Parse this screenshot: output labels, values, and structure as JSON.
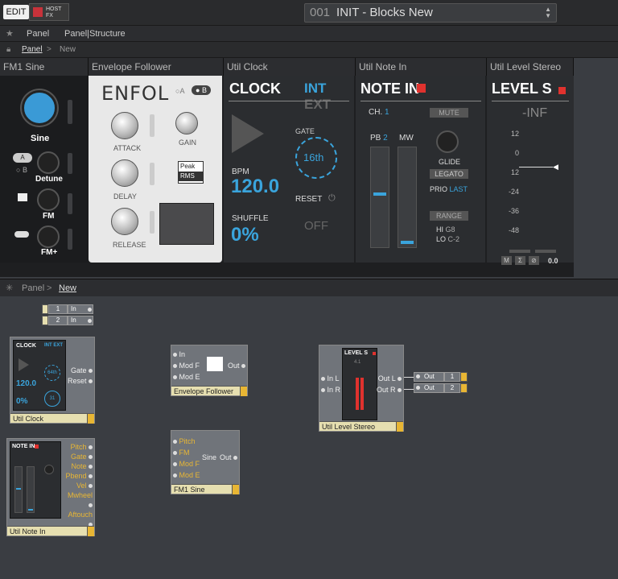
{
  "topbar": {
    "edit": "EDIT",
    "host_line1": "HOST",
    "host_line2": "FX",
    "preset_num": "001",
    "preset_name": "INIT - Blocks New"
  },
  "nav": {
    "panel": "Panel",
    "panel_structure": "Panel|Structure"
  },
  "breadcrumb1": {
    "panel": "Panel",
    "sep": ">",
    "new": "New"
  },
  "fm1": {
    "title": "FM1 Sine",
    "sine": "Sine",
    "a": "A",
    "b": "B",
    "detune": "Detune",
    "fm": "FM",
    "fmplus": "FM+"
  },
  "env": {
    "title": "Envelope Follower",
    "name": "ENFOL",
    "opt_a": "A",
    "opt_b": "B",
    "attack": "ATTACK",
    "gain": "GAIN",
    "delay": "DELAY",
    "release": "RELEASE",
    "peak": "Peak",
    "rms": "RMS"
  },
  "clock": {
    "title": "Util Clock",
    "name": "CLOCK",
    "int": "INT",
    "ext": "EXT",
    "gate_label": "GATE",
    "gate_val": "16th",
    "bpm_label": "BPM",
    "bpm_val": "120.0",
    "reset": "RESET",
    "shuffle_label": "SHUFFLE",
    "shuffle_val": "0%",
    "off": "OFF"
  },
  "note": {
    "title": "Util Note In",
    "name": "NOTE IN",
    "ch_label": "CH.",
    "ch_val": "1",
    "mute": "MUTE",
    "pb_label": "PB",
    "pb_val": "2",
    "mw": "MW",
    "glide": "GLIDE",
    "legato": "LEGATO",
    "prio_label": "PRIO",
    "prio_val": "LAST",
    "range": "RANGE",
    "hi_label": "HI",
    "hi_val": "G8",
    "lo_label": "LO",
    "lo_val": "C-2"
  },
  "level": {
    "title": "Util Level Stereo",
    "name": "LEVEL S",
    "inf": "-INF",
    "ticks": [
      "12",
      "0",
      "12",
      "-24",
      "-36",
      "-48"
    ],
    "m": "M",
    "s": "Σ",
    "p": "⊘",
    "val": "0.0"
  },
  "breadcrumb2": {
    "panel": "Panel",
    "sep": ">",
    "new": "New"
  },
  "canvas": {
    "inputs": {
      "r1n": "1",
      "r1t": "In",
      "r2n": "2",
      "r2t": "In"
    },
    "clock": {
      "footer": "Util Clock",
      "gate": "Gate",
      "reset": "Reset",
      "mini_name": "CLOCK",
      "mini_int": "INT EXT",
      "mini_bpm": "120.0",
      "mini_shuffle": "0%",
      "mini_gate": "64th",
      "mini_reset": "31"
    },
    "env": {
      "footer": "Envelope Follower",
      "in": "In",
      "modf": "Mod F",
      "mode": "Mod E",
      "out": "Out"
    },
    "level": {
      "footer": "Util Level Stereo",
      "inl": "In L",
      "inr": "In R",
      "outl": "Out L",
      "outr": "Out R",
      "mini_name": "LEVEL S",
      "mini_val": "4.1"
    },
    "outputs": {
      "o1": "Out",
      "n1": "1",
      "o2": "Out",
      "n2": "2"
    },
    "note": {
      "footer": "Util Note In",
      "ports": [
        "Pitch",
        "Gate",
        "Note",
        "Pbend",
        "Vel",
        "Mwheel",
        "Aftouch"
      ],
      "mini_name": "NOTE IN"
    },
    "fm": {
      "footer": "FM1 Sine",
      "ports": [
        "Pitch",
        "FM",
        "Mod F",
        "Mod E"
      ],
      "sine": "Sine",
      "out": "Out"
    }
  },
  "colors": {
    "accent": "#3aa4dc",
    "red": "#e0322e",
    "footer": "#e6dfb0",
    "footer_btn": "#e8b634"
  }
}
